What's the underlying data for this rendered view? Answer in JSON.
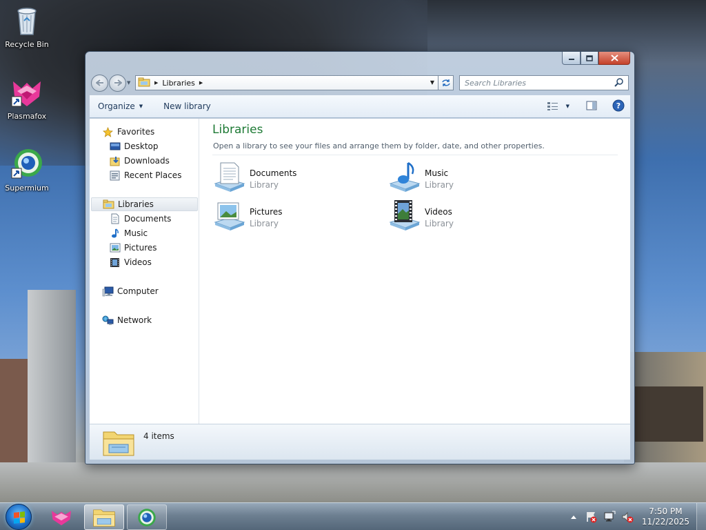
{
  "desktop": {
    "icons": [
      {
        "label": "Recycle Bin",
        "icon": "recycle-bin-icon"
      },
      {
        "label": "Plasmafox",
        "icon": "plasmafox-icon"
      },
      {
        "label": "Supermium",
        "icon": "supermium-icon"
      }
    ]
  },
  "window": {
    "address": {
      "crumb": "Libraries"
    },
    "search_placeholder": "Search Libraries",
    "toolbar": {
      "organize": "Organize",
      "new_library": "New library"
    },
    "nav": {
      "favorites": "Favorites",
      "desktop": "Desktop",
      "downloads": "Downloads",
      "recent_places": "Recent Places",
      "libraries": "Libraries",
      "documents": "Documents",
      "music": "Music",
      "pictures": "Pictures",
      "videos": "Videos",
      "computer": "Computer",
      "network": "Network"
    },
    "main": {
      "title": "Libraries",
      "subtitle": "Open a library to see your files and arrange them by folder, date, and other properties.",
      "libraries": [
        {
          "name": "Documents",
          "kind": "Library",
          "icon": "documents-library-icon"
        },
        {
          "name": "Music",
          "kind": "Library",
          "icon": "music-library-icon"
        },
        {
          "name": "Pictures",
          "kind": "Library",
          "icon": "pictures-library-icon"
        },
        {
          "name": "Videos",
          "kind": "Library",
          "icon": "videos-library-icon"
        }
      ]
    },
    "details": {
      "count": "4 items"
    }
  },
  "taskbar": {
    "clock": {
      "time": "7:50 PM",
      "date": "11/22/2025"
    }
  },
  "colors": {
    "title_green": "#1e7a35",
    "toolbar_text": "#1e395b",
    "close_red": "#c4412a"
  }
}
